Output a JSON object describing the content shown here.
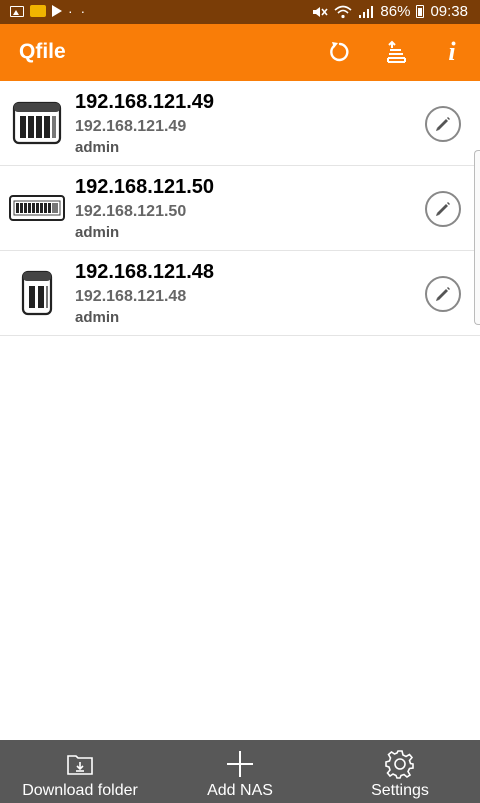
{
  "status_bar": {
    "left_icons": [
      "image-icon",
      "notification-icon",
      "play-icon",
      "more-dots-icon"
    ],
    "right_icons": [
      "mute-icon",
      "wifi-icon",
      "signal-icon",
      "battery-icon"
    ],
    "battery": "86%",
    "time": "09:38",
    "dots": "· ·"
  },
  "app_bar": {
    "title": "Qfile",
    "actions": [
      "refresh-icon",
      "transfer-stack-icon",
      "info-icon"
    ],
    "info_glyph": "i",
    "background": "#f97d08"
  },
  "nas_list": [
    {
      "title": "192.168.121.49",
      "address": "192.168.121.49",
      "user": "admin",
      "icon": "nas-5bay-icon"
    },
    {
      "title": "192.168.121.50",
      "address": "192.168.121.50",
      "user": "admin",
      "icon": "nas-rack-icon"
    },
    {
      "title": "192.168.121.48",
      "address": "192.168.121.48",
      "user": "admin",
      "icon": "nas-2bay-icon"
    }
  ],
  "bottom_nav": {
    "download_folder": "Download folder",
    "add_nas": "Add NAS",
    "settings": "Settings",
    "background": "#585858"
  }
}
